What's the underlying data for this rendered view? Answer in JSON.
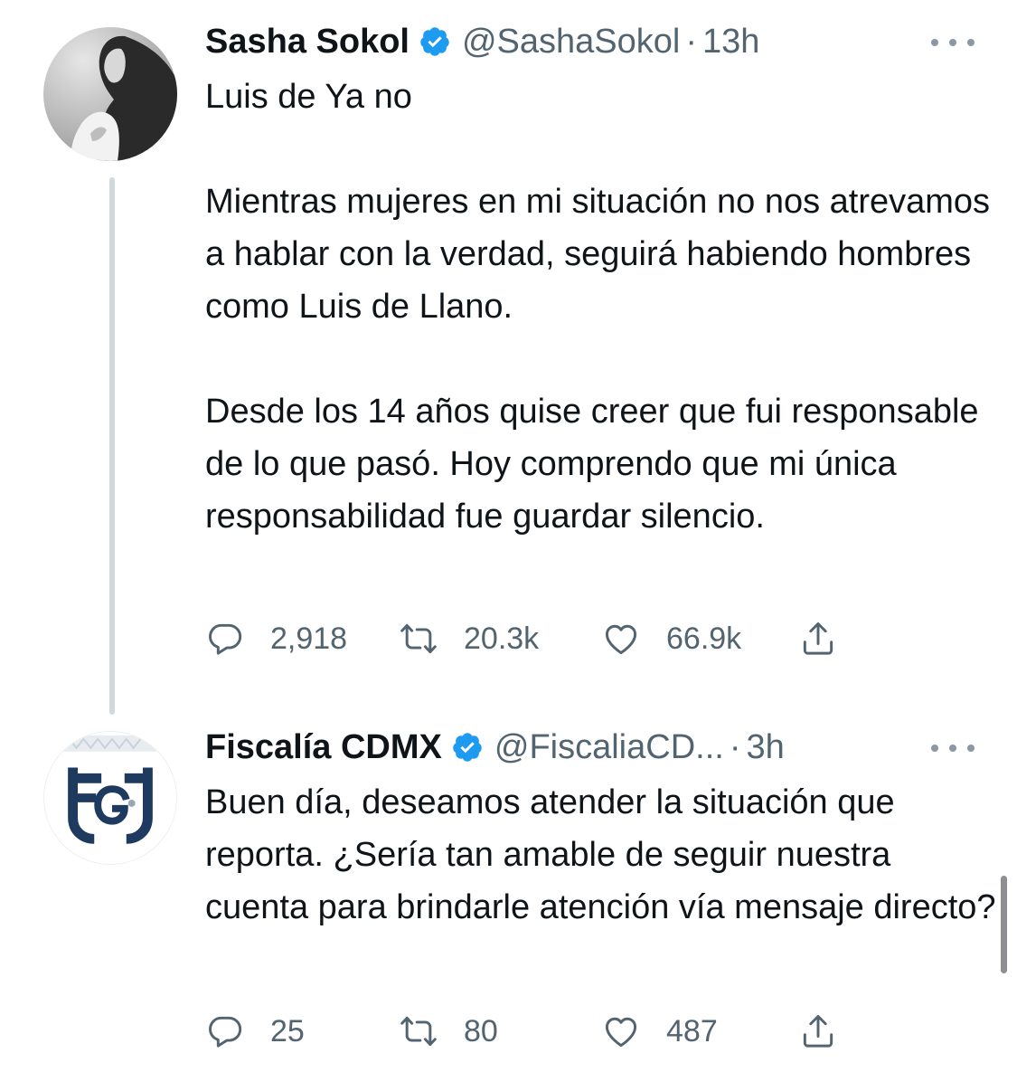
{
  "tweets": [
    {
      "author_name": "Sasha Sokol",
      "handle": "@SashaSokol",
      "separator": "·",
      "time": "13h",
      "text": "Luis de Ya no\n\nMientras mujeres en mi situación no nos atrevamos a hablar con la verdad, seguirá habiendo hombres como Luis de Llano.\n\nDesde los 14 años quise creer que fui responsable de lo que pasó. Hoy comprendo que mi única responsabilidad fue guardar silencio.",
      "replies": "2,918",
      "retweets": "20.3k",
      "likes": "66.9k",
      "avatar": "profile-photo"
    },
    {
      "author_name": "Fiscalía CDMX",
      "handle": "@FiscaliaCD...",
      "separator": "·",
      "time": "3h",
      "text": "Buen día, deseamos atender la situación que reporta. ¿Sería tan amable de seguir nuestra cuenta para brindarle atención vía mensaje directo?",
      "replies": "25",
      "retweets": "80",
      "likes": "487",
      "avatar": "fgj-logo"
    }
  ],
  "icons": {
    "verified": "verified-badge-icon",
    "more": "more-icon",
    "reply": "reply-icon",
    "retweet": "retweet-icon",
    "like": "heart-icon",
    "share": "share-icon"
  },
  "colors": {
    "verified_blue": "#1d9bf0",
    "secondary_text": "#536471",
    "primary_text": "#0f1419",
    "fgj_navy": "#1f3a5f"
  }
}
